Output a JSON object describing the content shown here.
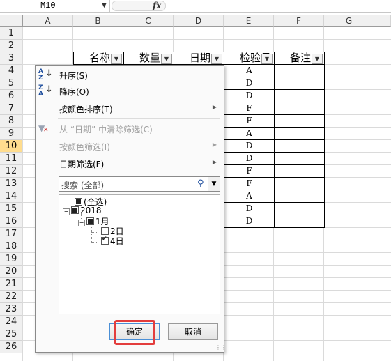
{
  "formula_bar": {
    "name_box": "M10",
    "fx": "fx"
  },
  "columns": [
    "A",
    "B",
    "C",
    "D",
    "E",
    "F",
    "G"
  ],
  "rows": [
    "1",
    "2",
    "3",
    "4",
    "5",
    "6",
    "7",
    "8",
    "9",
    "10",
    "11",
    "12",
    "13",
    "14",
    "15",
    "16",
    "17",
    "18",
    "19",
    "20",
    "21",
    "22",
    "23",
    "24",
    "25",
    "26"
  ],
  "selected_row": "10",
  "table": {
    "headers": [
      "名称",
      "数量",
      "日期",
      "检验员",
      "备注"
    ],
    "inspectors": [
      "A",
      "D",
      "D",
      "F",
      "F",
      "A",
      "D",
      "D",
      "F",
      "F",
      "A",
      "D",
      "D"
    ]
  },
  "filter_menu": {
    "sort_asc": "升序(S)",
    "sort_desc": "降序(O)",
    "sort_by_color": "按颜色排序(T)",
    "clear_filter": "从 “日期” 中清除筛选(C)",
    "filter_by_color": "按颜色筛选(I)",
    "date_filters": "日期筛选(F)",
    "search_placeholder": "搜索 (全部)",
    "tree": {
      "select_all": "(全选)",
      "year": "2018",
      "month": "1月",
      "day1": "2日",
      "day2": "4日"
    },
    "ok": "确定",
    "cancel": "取消"
  },
  "icons": {
    "sort_asc": "sort-ascending-icon",
    "sort_desc": "sort-descending-icon",
    "clear_filter": "clear-filter-icon",
    "search": "search-icon"
  },
  "colors": {
    "highlight": "#e33d3d",
    "selected_row": "#ffdd8f",
    "accent": "#1f4e9d"
  }
}
